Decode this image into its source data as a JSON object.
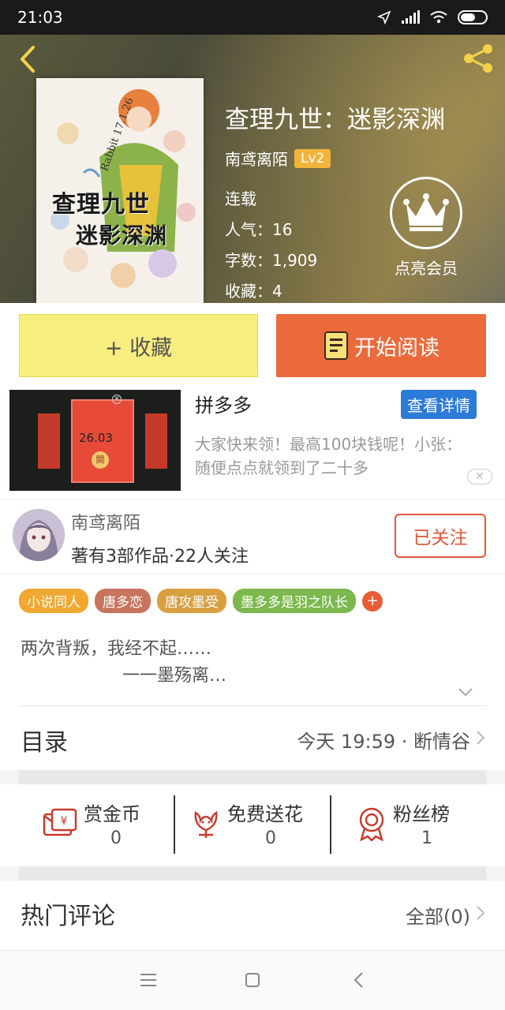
{
  "status_bar": {
    "time": "21:03"
  },
  "book": {
    "title": "查理九世：迷影深渊",
    "author": "南鸢离陌",
    "level": "Lv2",
    "status": "连载",
    "popularity": "人气：16",
    "word_count": "字数：1,909",
    "favorites": "收藏：4",
    "cover_title_line1": "查理九世",
    "cover_title_line2": "迷影深渊",
    "cover_signature": "Rabbit 17.1.26"
  },
  "vip": {
    "label": "点亮会员"
  },
  "actions": {
    "collect_label": "+ 收藏",
    "read_label": "开始阅读"
  },
  "ad": {
    "title": "拼多多",
    "detail_label": "查看详情",
    "text": "大家快来领！最高100块钱呢！小张：随便点点就领到了二十多",
    "amount": "26.03",
    "coin": "開"
  },
  "author_card": {
    "name": "南鸢离陌",
    "info": "著有3部作品·22人关注",
    "follow_label": "已关注"
  },
  "tags": [
    {
      "label": "小说同人",
      "color": "#f0a830"
    },
    {
      "label": "唐多恋",
      "color": "#c8745e"
    },
    {
      "label": "唐攻墨受",
      "color": "#d9a040"
    },
    {
      "label": "墨多多是羽之队长",
      "color": "#7cb84e"
    }
  ],
  "tag_add": "+",
  "synopsis": {
    "line1": "两次背叛，我经不起……",
    "line2": "一一墨殇离…"
  },
  "toc": {
    "label": "目录",
    "latest": "今天 19:59 · 断情谷"
  },
  "gifts": [
    {
      "label": "赏金币",
      "count": "0"
    },
    {
      "label": "免费送花",
      "count": "0"
    },
    {
      "label": "粉丝榜",
      "count": "1"
    }
  ],
  "comments": {
    "label": "热门评论",
    "all_label": "全部(0)"
  },
  "colors": {
    "accent_orange": "#ea6a3c",
    "collect_yellow": "#f8ee80",
    "follow_red": "#e2573a",
    "ad_blue": "#2d7bd9",
    "level_badge": "#f1b43a"
  }
}
